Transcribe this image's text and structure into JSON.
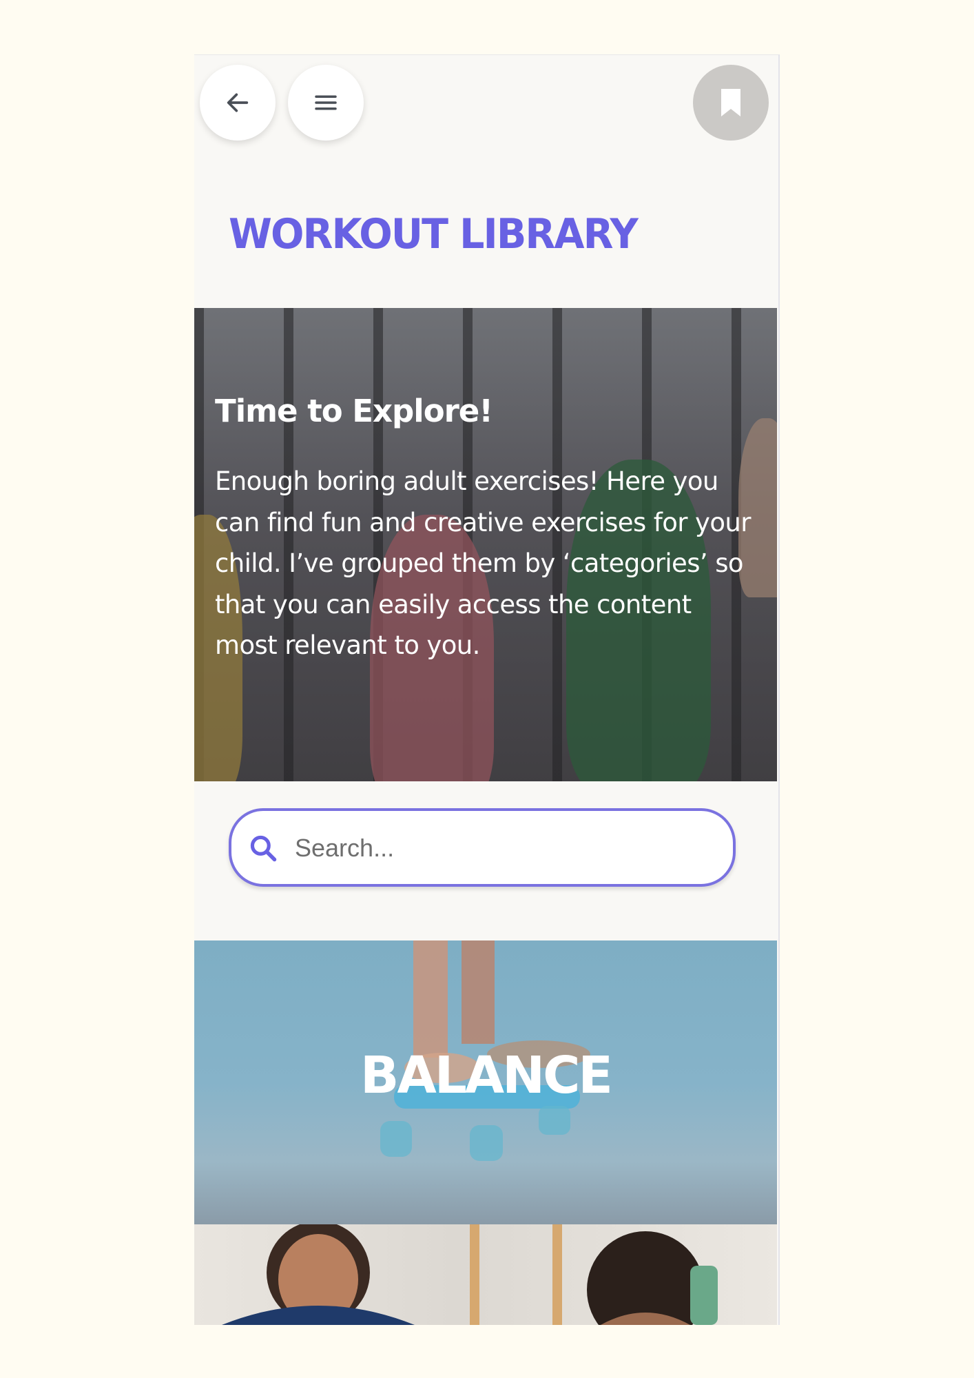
{
  "header": {
    "back_icon": "arrow-left-icon",
    "menu_icon": "hamburger-menu-icon",
    "bookmark_icon": "bookmark-icon",
    "title": "WORKOUT LIBRARY"
  },
  "hero": {
    "title": "Time to Explore!",
    "text": "Enough boring adult exercises! Here you can find fun and creative exercises for your child. I’ve grouped them by ‘categories’ so that you can easily access the content most relevant to you."
  },
  "search": {
    "placeholder": "Search...",
    "icon": "search-icon"
  },
  "categories": [
    {
      "label": "BALANCE"
    },
    {
      "label": ""
    }
  ],
  "colors": {
    "accent": "#6861e3",
    "search_border": "#7a72e0",
    "page_background": "#fffcf2",
    "bookmark_button": "#cbc9c6"
  }
}
